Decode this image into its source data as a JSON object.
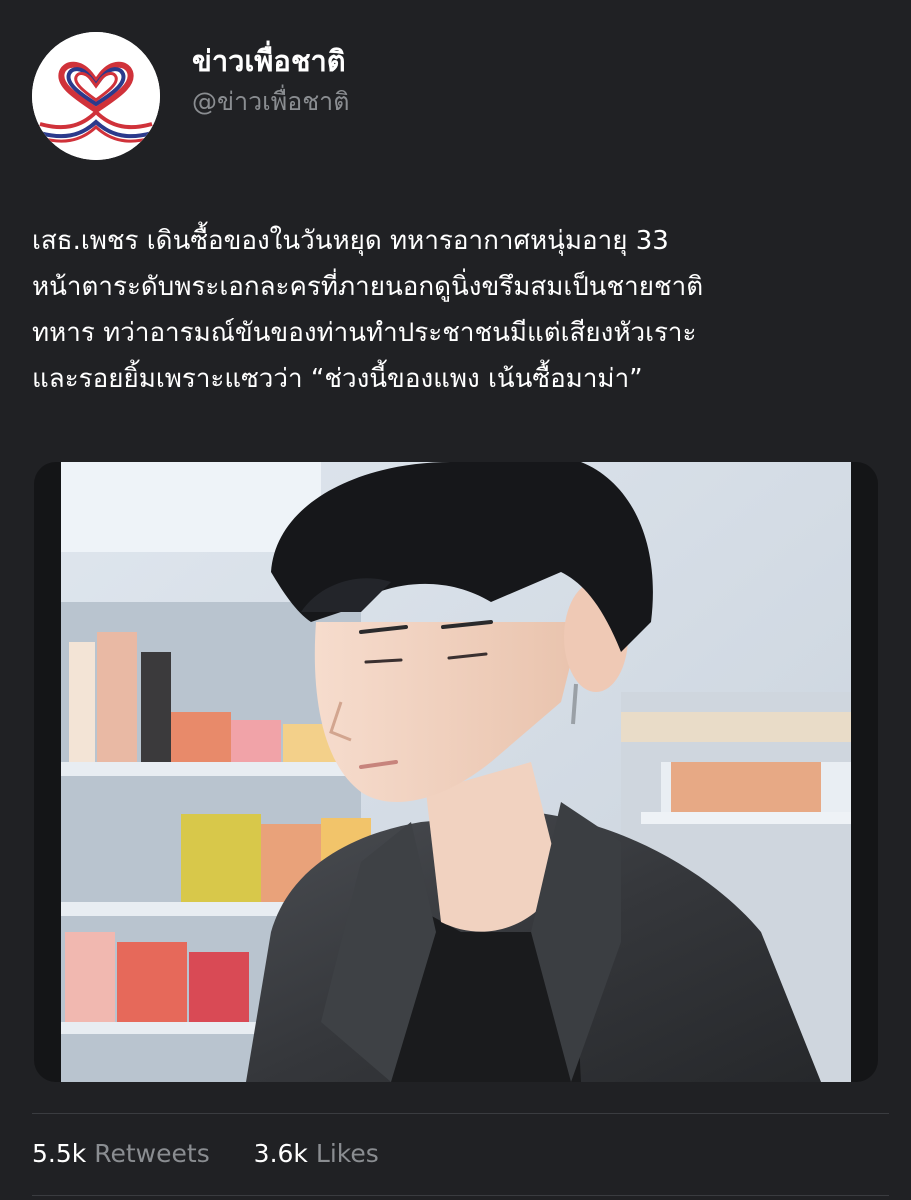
{
  "account": {
    "display_name": "ข่าวเพื่อชาติ",
    "handle": "@ข่าวเพื่อชาติ",
    "avatar_icon": "heart-ribbon-logo"
  },
  "tweet": {
    "lines": [
      "เสธ.เพชร เดินซื้อของในวันหยุด ทหารอากาศหนุ่มอายุ 33",
      "หน้าตาระดับพระเอกละครที่ภายนอกดูนิ่งขรึมสมเป็นชายชาติ",
      "ทหาร   ทว่าอารมณ์ขันของท่านทำประชาชนมีแต่เสียงหัวเราะ",
      "และรอยยิ้มเพราะแซวว่า “ช่วงนี้ของแพง เน้นซื้อมาม่า”"
    ]
  },
  "stats": {
    "retweets_count": "5.5k",
    "retweets_label": "Retweets",
    "likes_count": "3.6k",
    "likes_label": "Likes"
  },
  "colors": {
    "background": "#202124",
    "secondary_text": "#8a8d91",
    "divider": "#3a3c40",
    "flag_red": "#d0323a",
    "flag_blue": "#2b3a8c"
  }
}
